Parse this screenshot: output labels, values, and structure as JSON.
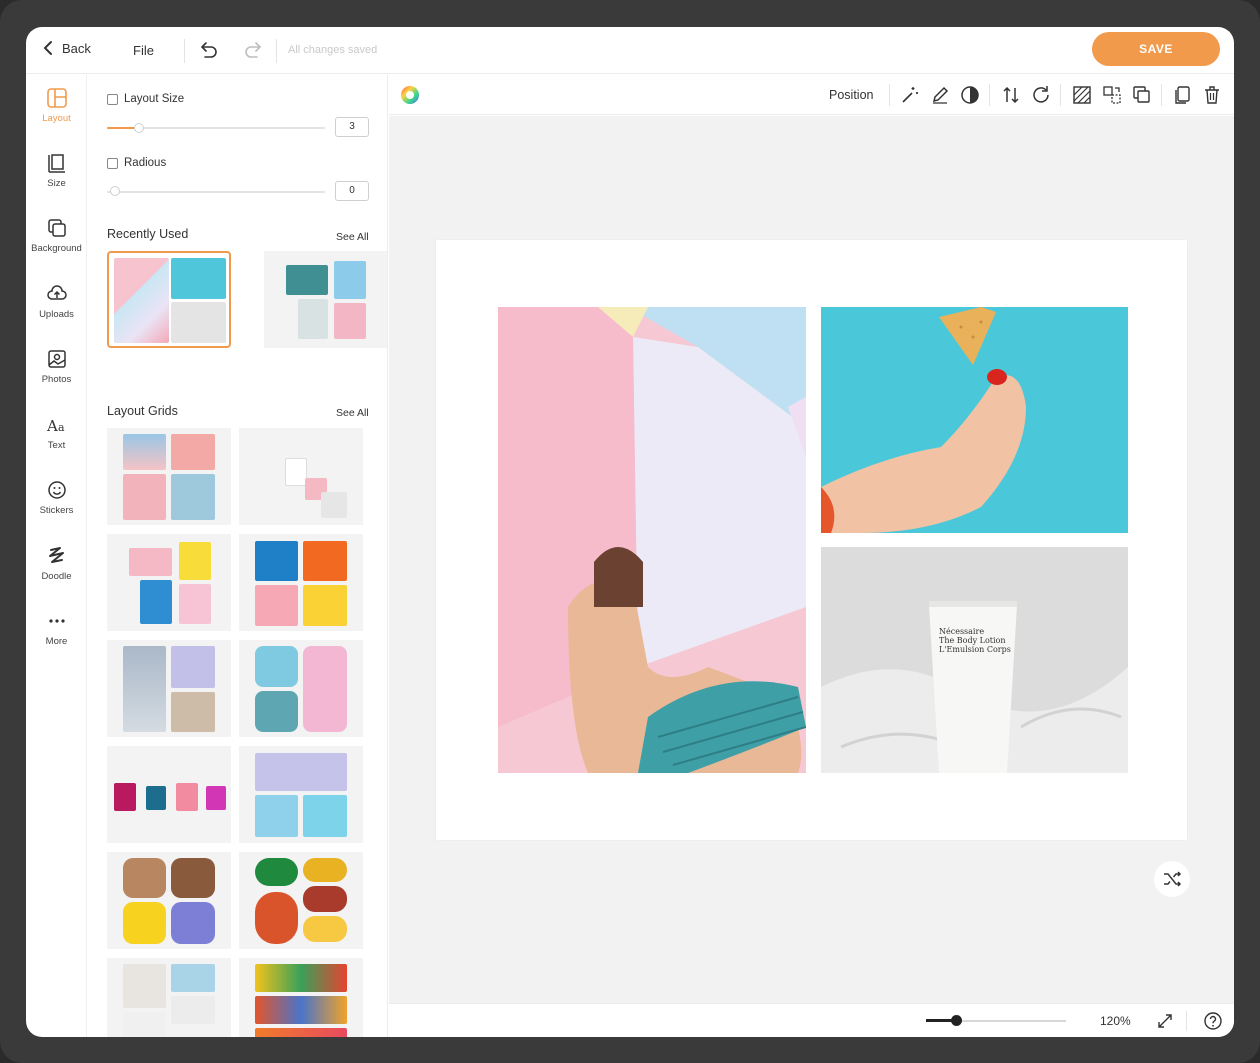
{
  "topbar": {
    "back_label": "Back",
    "file_label": "File",
    "status": "All changes saved",
    "save_label": "SAVE"
  },
  "rail": {
    "items": [
      {
        "label": "Layout",
        "icon": "layout-icon",
        "active": true
      },
      {
        "label": "Size",
        "icon": "size-icon"
      },
      {
        "label": "Background",
        "icon": "background-icon"
      },
      {
        "label": "Uploads",
        "icon": "upload-cloud-icon"
      },
      {
        "label": "Photos",
        "icon": "photo-icon"
      },
      {
        "label": "Text",
        "icon": "text-icon"
      },
      {
        "label": "Stickers",
        "icon": "smiley-icon"
      },
      {
        "label": "Doodle",
        "icon": "doodle-icon"
      },
      {
        "label": "More",
        "icon": "more-dots-icon"
      }
    ]
  },
  "panel": {
    "layout_size_label": "Layout Size",
    "layout_size_value": "3",
    "radius_label": "Radious",
    "radius_value": "0",
    "recently_used_title": "Recently Used",
    "layout_grids_title": "Layout Grids",
    "see_all": "See All"
  },
  "toolbar": {
    "position_label": "Position"
  },
  "canvas": {
    "product_text": "Nécessaire\nThe Body Lotion\nL'Emulsion Corps"
  },
  "zoom": {
    "value": "120%",
    "level": 0.23
  },
  "colors": {
    "accent": "#f19a4c",
    "canvas_bg": "#f2f2f2"
  }
}
